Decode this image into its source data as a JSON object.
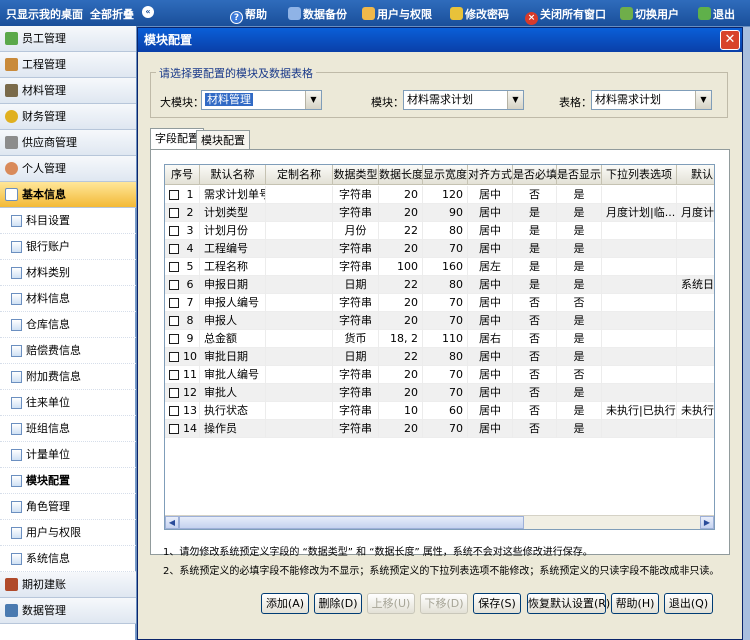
{
  "topbar": {
    "desktop": "只显示我的桌面",
    "expand_all": "全部折叠",
    "help": "帮助",
    "backup": "数据备份",
    "users": "用户与权限",
    "password": "修改密码",
    "close_all": "关闭所有窗口",
    "switch_user": "切换用户",
    "exit": "退出"
  },
  "sidebar": {
    "groups": [
      "员工管理",
      "工程管理",
      "材料管理",
      "财务管理",
      "供应商管理",
      "个人管理",
      "基本信息"
    ],
    "items": [
      "科目设置",
      "银行账户",
      "材料类别",
      "材料信息",
      "仓库信息",
      "赔偿费信息",
      "附加费信息",
      "往来单位",
      "班组信息",
      "计量单位",
      "模块配置",
      "角色管理",
      "用户与权限",
      "系统信息"
    ],
    "bottom_groups": [
      "期初建账",
      "数据管理"
    ]
  },
  "dialog": {
    "title": "模块配置",
    "fieldset_legend": "请选择要配置的模块及数据表格",
    "big_module_label": "大模块：",
    "big_module_value": "材料管理",
    "module_label": "模块：",
    "module_value": "材料需求计划",
    "table_label": "表格：",
    "table_value": "材料需求计划",
    "tabs": [
      "字段配置",
      "模块配置"
    ],
    "columns": [
      "序号",
      "默认名称",
      "定制名称",
      "数据类型",
      "数据长度",
      "显示宽度",
      "对齐方式",
      "是否必填",
      "是否显示",
      "下拉列表选项",
      "默认"
    ],
    "rows": [
      [
        "1",
        "需求计划单号",
        "",
        "字符串",
        "20",
        "120",
        "居中",
        "否",
        "是",
        "",
        ""
      ],
      [
        "2",
        "计划类型",
        "",
        "字符串",
        "20",
        "90",
        "居中",
        "是",
        "是",
        "月度计划|临...",
        "月度计..."
      ],
      [
        "3",
        "计划月份",
        "",
        "月份",
        "22",
        "80",
        "居中",
        "是",
        "是",
        "",
        ""
      ],
      [
        "4",
        "工程编号",
        "",
        "字符串",
        "20",
        "70",
        "居中",
        "是",
        "是",
        "",
        ""
      ],
      [
        "5",
        "工程名称",
        "",
        "字符串",
        "100",
        "160",
        "居左",
        "是",
        "是",
        "",
        ""
      ],
      [
        "6",
        "申报日期",
        "",
        "日期",
        "22",
        "80",
        "居中",
        "是",
        "是",
        "",
        "系统日..."
      ],
      [
        "7",
        "申报人编号",
        "",
        "字符串",
        "20",
        "70",
        "居中",
        "否",
        "否",
        "",
        ""
      ],
      [
        "8",
        "申报人",
        "",
        "字符串",
        "20",
        "70",
        "居中",
        "否",
        "是",
        "",
        ""
      ],
      [
        "9",
        "总金额",
        "",
        "货币",
        "18, 2",
        "110",
        "居右",
        "否",
        "是",
        "",
        ""
      ],
      [
        "10",
        "审批日期",
        "",
        "日期",
        "22",
        "80",
        "居中",
        "否",
        "是",
        "",
        ""
      ],
      [
        "11",
        "审批人编号",
        "",
        "字符串",
        "20",
        "70",
        "居中",
        "否",
        "否",
        "",
        ""
      ],
      [
        "12",
        "审批人",
        "",
        "字符串",
        "20",
        "70",
        "居中",
        "否",
        "是",
        "",
        ""
      ],
      [
        "13",
        "执行状态",
        "",
        "字符串",
        "10",
        "60",
        "居中",
        "否",
        "是",
        "未执行|已执行|",
        "未执行..."
      ],
      [
        "14",
        "操作员",
        "",
        "字符串",
        "20",
        "70",
        "居中",
        "否",
        "是",
        "",
        ""
      ]
    ],
    "notes": [
      "1、请勿修改系统预定义字段的 “数据类型” 和 “数据长度” 属性，系统不会对这些修改进行保存。",
      "2、系统预定义的必填字段不能修改为不显示；系统预定义的下拉列表选项不能修改；系统预定义的只读字段不能改成非只读。"
    ],
    "buttons": {
      "add": "添加(A)",
      "delete": "删除(D)",
      "up": "上移(U)",
      "down": "下移(D)",
      "save": "保存(S)",
      "restore": "恢复默认设置(R)",
      "help": "帮助(H)",
      "exit": "退出(Q)"
    }
  },
  "colors": {
    "title_bar": "#0a4fc0",
    "active_group": "#f3b936",
    "close_button": "#d8432a"
  }
}
